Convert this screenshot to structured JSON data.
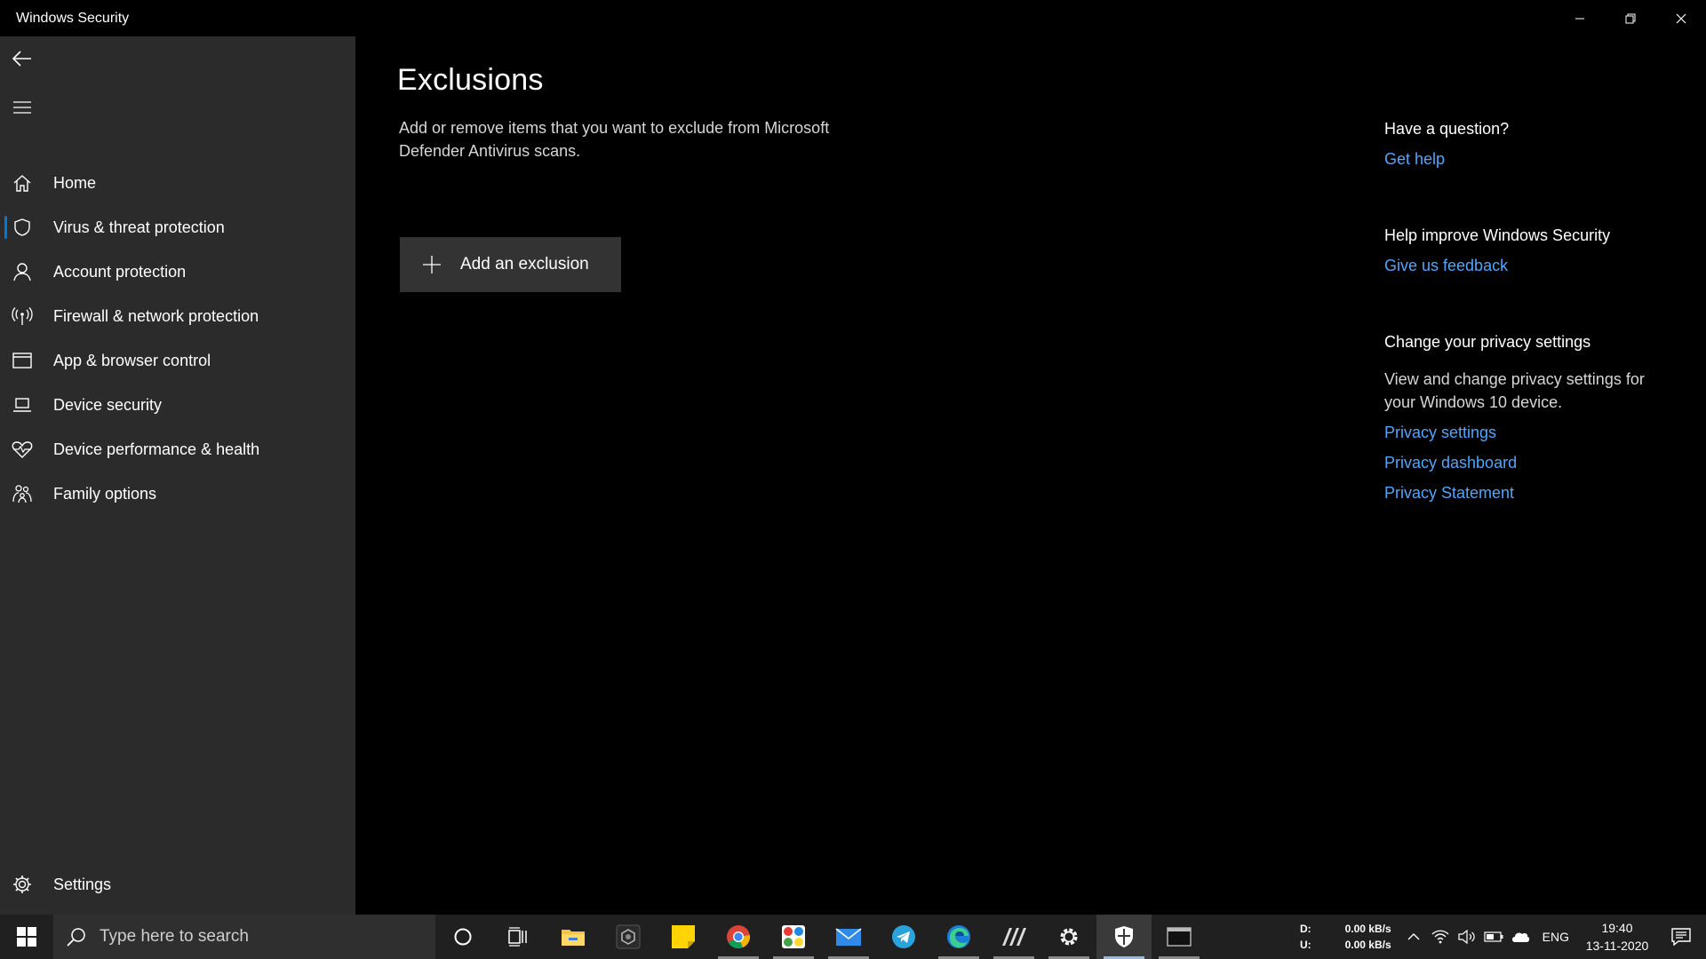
{
  "window": {
    "title": "Windows Security",
    "controls": {
      "minimize": "minimize-icon",
      "restore": "restore-icon",
      "close": "close-icon"
    }
  },
  "sidebar": {
    "items": [
      {
        "label": "Home",
        "icon": "home-icon"
      },
      {
        "label": "Virus & threat protection",
        "icon": "shield-icon",
        "active": true
      },
      {
        "label": "Account protection",
        "icon": "person-icon"
      },
      {
        "label": "Firewall & network protection",
        "icon": "antenna-icon"
      },
      {
        "label": "App & browser control",
        "icon": "browser-window-icon"
      },
      {
        "label": "Device security",
        "icon": "laptop-icon"
      },
      {
        "label": "Device performance & health",
        "icon": "heart-pulse-icon"
      },
      {
        "label": "Family options",
        "icon": "family-icon"
      }
    ],
    "settings_label": "Settings"
  },
  "main": {
    "title": "Exclusions",
    "description": "Add or remove items that you want to exclude from Microsoft Defender Antivirus scans.",
    "add_button_label": "Add an exclusion"
  },
  "aside": {
    "question_heading": "Have a question?",
    "get_help": "Get help",
    "improve_heading": "Help improve Windows Security",
    "feedback": "Give us feedback",
    "privacy_heading": "Change your privacy settings",
    "privacy_text": "View and change privacy settings for your Windows 10 device.",
    "privacy_settings": "Privacy settings",
    "privacy_dashboard": "Privacy dashboard",
    "privacy_statement": "Privacy Statement"
  },
  "taskbar": {
    "search_placeholder": "Type here to search",
    "net": {
      "down_label": "D:",
      "up_label": "U:",
      "down_value": "0.00 kB/s",
      "up_value": "0.00 kB/s"
    },
    "language": "ENG",
    "time": "19:40",
    "date": "13-11-2020"
  },
  "colors": {
    "accent": "#0078d7",
    "link": "#4ea6ff",
    "sidebar_bg": "#2b2b2b",
    "main_bg": "#000000",
    "button_bg": "#333333"
  }
}
